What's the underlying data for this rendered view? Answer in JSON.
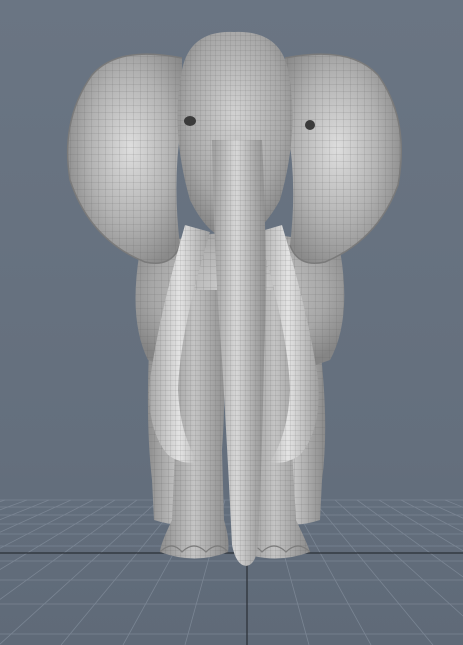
{
  "viewport": {
    "view": "front",
    "projection": "perspective",
    "grid_visible": true,
    "display_mode": "shaded-wireframe"
  },
  "model": {
    "subject": "elephant",
    "icon": "elephant-model-icon"
  },
  "colors": {
    "background": "#66717f",
    "grid_line": "#7a8593",
    "grid_axis": "#2a2f36",
    "mesh_base": "#b9b9b9",
    "mesh_shadow": "#7d7d7d",
    "mesh_highlight": "#e6e6e6",
    "wire": "#5c5c5c"
  }
}
